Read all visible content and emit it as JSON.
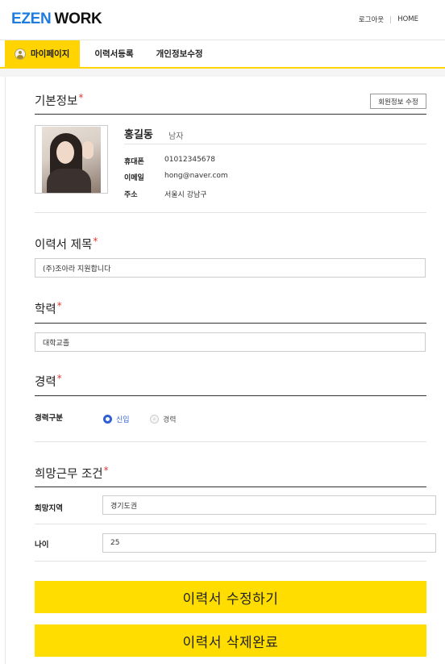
{
  "header": {
    "logo_part1": "EZEN",
    "logo_part2": "WORK",
    "logout_label": "로그아웃",
    "home_label": "HOME"
  },
  "tabs": [
    {
      "label": "마이페이지",
      "active": true
    },
    {
      "label": "이력서등록",
      "active": false
    },
    {
      "label": "개인정보수정",
      "active": false
    }
  ],
  "basic_info": {
    "title": "기본정보",
    "required_mark": "*",
    "edit_button": "회원정보 수정",
    "name": "홍길동",
    "gender": "남자",
    "phone_label": "휴대폰",
    "phone": "01012345678",
    "email_label": "이메일",
    "email": "hong@naver.com",
    "address_label": "주소",
    "address": "서울시 강남구"
  },
  "resume_title": {
    "title": "이력서 제목",
    "required_mark": "*",
    "value": "(주)조아라 지원합니다"
  },
  "education": {
    "title": "학력",
    "required_mark": "*",
    "value": "대학교졸"
  },
  "career": {
    "title": "경력",
    "required_mark": "*",
    "type_label": "경력구분",
    "options": [
      {
        "label": "신입",
        "selected": true
      },
      {
        "label": "경력",
        "selected": false
      }
    ]
  },
  "conditions": {
    "title": "희망근무 조건",
    "required_mark": "*",
    "region_label": "희망지역",
    "region": "경기도권",
    "age_label": "나이",
    "age": "25"
  },
  "actions": {
    "edit_resume": "이력서 수정하기",
    "delete_resume": "이력서 삭제완료"
  },
  "colors": {
    "accent": "#ffdd00",
    "tab_active": "#ffd400",
    "logo_blue": "#1d7ce0",
    "radio_blue": "#2f5fd0",
    "required_red": "#e53935"
  }
}
